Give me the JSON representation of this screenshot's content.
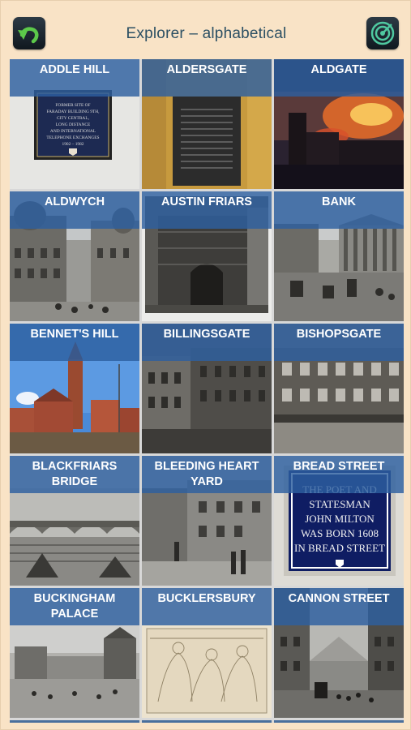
{
  "header": {
    "title": "Explorer – alphabetical",
    "back_icon": "undo-arrow-icon",
    "radar_icon": "radar-icon"
  },
  "tiles": [
    {
      "label": "ADDLE HILL"
    },
    {
      "label": "ALDERSGATE"
    },
    {
      "label": "ALDGATE"
    },
    {
      "label": "ALDWYCH"
    },
    {
      "label": "AUSTIN FRIARS"
    },
    {
      "label": "BANK"
    },
    {
      "label": "BENNET'S HILL"
    },
    {
      "label": "BILLINGSGATE"
    },
    {
      "label": "BISHOPSGATE"
    },
    {
      "label": "BLACKFRIARS BRIDGE"
    },
    {
      "label": "BLEEDING HEART YARD"
    },
    {
      "label": "BREAD STREET"
    },
    {
      "label": "BUCKINGHAM PALACE"
    },
    {
      "label": "BUCKLERSBURY"
    },
    {
      "label": "CANNON STREET"
    }
  ],
  "plaques": {
    "addle_hill": [
      "FORMER SITE OF",
      "FARADAY BUILDING 9TH,",
      "CITY CENTRAL,",
      "LONG DISTANCE",
      "AND INTERNATIONAL",
      "TELEPHONE EXCHANGES",
      "1902 – 1982"
    ],
    "bread_street": [
      "THE POET AND",
      "STATESMAN",
      "JOHN MILTON",
      "WAS BORN 1608",
      "IN BREAD STREET"
    ]
  },
  "colors": {
    "background": "#f9e3c6",
    "title": "#2b4f63",
    "label_band": "#2d5fa0"
  }
}
